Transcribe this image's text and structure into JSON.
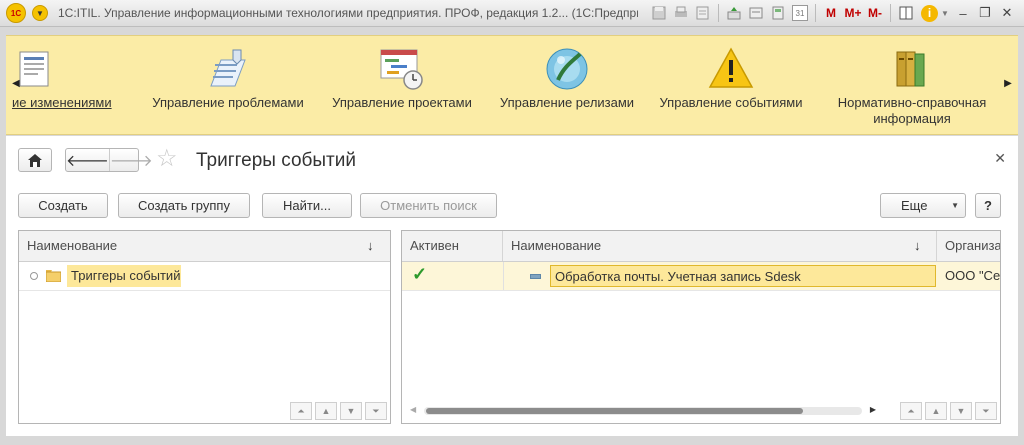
{
  "window": {
    "title": "1С:ITIL. Управление информационными технологиями предприятия. ПРОФ, редакция 1.2...   (1С:Предприятие)",
    "logo_text": "1С",
    "memory_buttons": [
      "M",
      "M+",
      "M-"
    ],
    "calendar_day": "31"
  },
  "sections": [
    {
      "label": "ие изменениями",
      "icon": "change-management-icon"
    },
    {
      "label": "Управление проблемами",
      "icon": "problem-management-icon"
    },
    {
      "label": "Управление проектами",
      "icon": "project-management-icon"
    },
    {
      "label": "Управление релизами",
      "icon": "release-management-icon"
    },
    {
      "label": "Управление событиями",
      "icon": "warning-icon"
    },
    {
      "label1": "Нормативно-справочная",
      "label2": "информация",
      "icon": "reference-books-icon"
    }
  ],
  "form": {
    "title": "Триггеры событий",
    "buttons": {
      "create": "Создать",
      "create_group": "Создать группу",
      "find": "Найти...",
      "cancel_search": "Отменить поиск",
      "more": "Еще",
      "help": "?"
    },
    "left_grid": {
      "column": "Наименование",
      "rows": [
        {
          "name": "Триггеры событий"
        }
      ]
    },
    "right_grid": {
      "columns": [
        "Активен",
        "Наименование",
        "Организа"
      ],
      "rows": [
        {
          "active": true,
          "name": "Обработка почты. Учетная запись Sdesk",
          "organization": "ООО \"Се"
        }
      ]
    }
  }
}
